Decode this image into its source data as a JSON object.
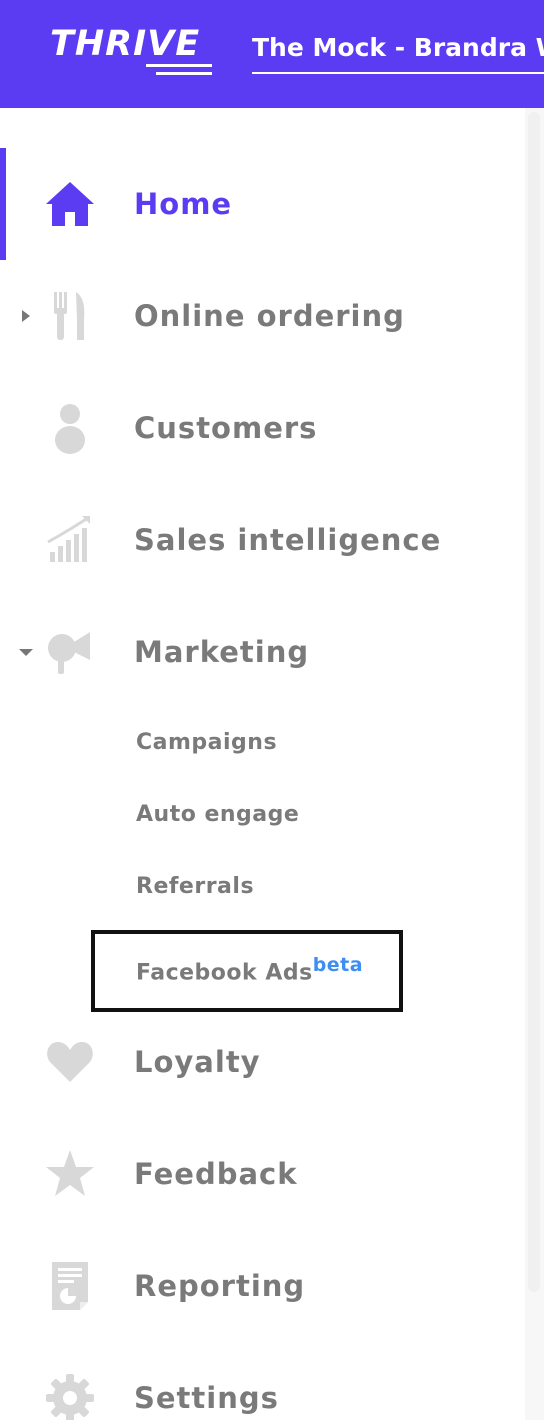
{
  "header": {
    "logo": "THRIVE",
    "title": "The Mock - Brandra We"
  },
  "sidebar": {
    "items": [
      {
        "label": "Home",
        "icon": "home-icon",
        "active": true
      },
      {
        "label": "Online ordering",
        "icon": "fork-knife-icon",
        "expandable": true,
        "expanded": false
      },
      {
        "label": "Customers",
        "icon": "person-icon"
      },
      {
        "label": "Sales intelligence",
        "icon": "bar-chart-icon"
      },
      {
        "label": "Marketing",
        "icon": "megaphone-icon",
        "expandable": true,
        "expanded": true,
        "children": [
          {
            "label": "Campaigns"
          },
          {
            "label": "Auto engage"
          },
          {
            "label": "Referrals"
          },
          {
            "label": "Facebook Ads",
            "badge": "beta"
          }
        ]
      },
      {
        "label": "Loyalty",
        "icon": "heart-icon"
      },
      {
        "label": "Feedback",
        "icon": "star-icon"
      },
      {
        "label": "Reporting",
        "icon": "report-icon"
      },
      {
        "label": "Settings",
        "icon": "gear-icon"
      }
    ]
  },
  "colors": {
    "brand": "#5c3cf2",
    "text_inactive": "#7a7a7a",
    "icon_inactive": "#d8d8d8",
    "beta": "#3d8ef0"
  }
}
